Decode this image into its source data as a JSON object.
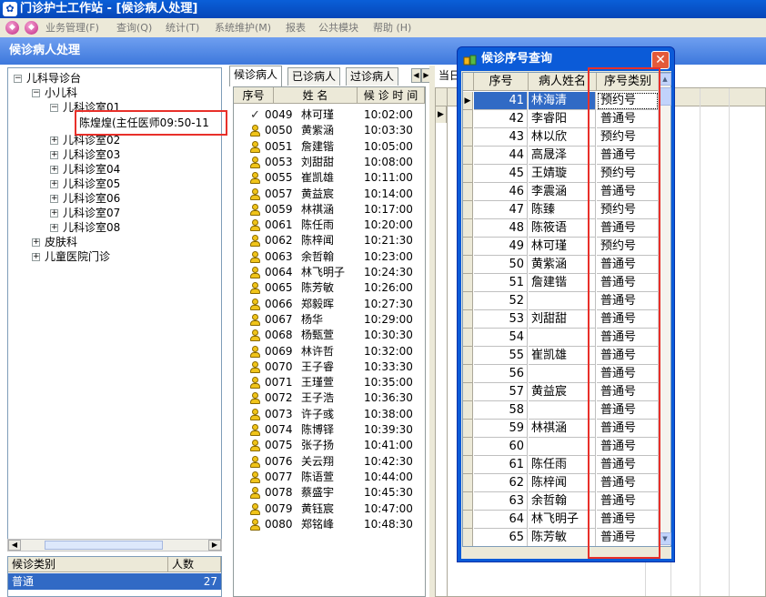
{
  "window": {
    "title": "门诊护士工作站 - [候诊病人处理]"
  },
  "menu": [
    "业务管理(F)",
    "查询(Q)",
    "统计(T)",
    "系统维护(M)",
    "报表",
    "公共模块",
    "帮助 (H)"
  ],
  "header": {
    "title": "候诊病人处理"
  },
  "tree": {
    "root": "儿科导诊台",
    "dept": "小儿科",
    "room_open": "儿科诊室01",
    "doctor": "陈煌煌(主任医师09:50-11",
    "rooms": [
      "儿科诊室02",
      "儿科诊室03",
      "儿科诊室04",
      "儿科诊室05",
      "儿科诊室06",
      "儿科诊室07",
      "儿科诊室08"
    ],
    "others": [
      "皮肤科",
      "儿童医院门诊"
    ]
  },
  "left_grid": {
    "col1": "候诊类别",
    "col2": "人数",
    "row_type": "普通",
    "row_count": "27"
  },
  "tabs": [
    "候诊病人",
    "已诊病人",
    "过诊病人"
  ],
  "right_label": "当日",
  "mid_list": {
    "headers": [
      "序号",
      "姓 名",
      "候 诊 时 间"
    ],
    "rows": [
      {
        "num": "0049",
        "name": "林可瑾",
        "time": "10:02:00"
      },
      {
        "num": "0050",
        "name": "黄紫涵",
        "time": "10:03:30"
      },
      {
        "num": "0051",
        "name": "詹建锴",
        "time": "10:05:00"
      },
      {
        "num": "0053",
        "name": "刘甜甜",
        "time": "10:08:00"
      },
      {
        "num": "0055",
        "name": "崔凯雄",
        "time": "10:11:00"
      },
      {
        "num": "0057",
        "name": "黄益宸",
        "time": "10:14:00"
      },
      {
        "num": "0059",
        "name": "林祺涵",
        "time": "10:17:00"
      },
      {
        "num": "0061",
        "name": "陈任雨",
        "time": "10:20:00"
      },
      {
        "num": "0062",
        "name": "陈梓闻",
        "time": "10:21:30"
      },
      {
        "num": "0063",
        "name": "余哲翰",
        "time": "10:23:00"
      },
      {
        "num": "0064",
        "name": "林飞明子",
        "time": "10:24:30"
      },
      {
        "num": "0065",
        "name": "陈芳敏",
        "time": "10:26:00"
      },
      {
        "num": "0066",
        "name": "郑毅晖",
        "time": "10:27:30"
      },
      {
        "num": "0067",
        "name": "杨华",
        "time": "10:29:00"
      },
      {
        "num": "0068",
        "name": "杨甄萱",
        "time": "10:30:30"
      },
      {
        "num": "0069",
        "name": "林许哲",
        "time": "10:32:00"
      },
      {
        "num": "0070",
        "name": "王子睿",
        "time": "10:33:30"
      },
      {
        "num": "0071",
        "name": "王瑾萱",
        "time": "10:35:00"
      },
      {
        "num": "0072",
        "name": "王子浩",
        "time": "10:36:30"
      },
      {
        "num": "0073",
        "name": "许子彧",
        "time": "10:38:00"
      },
      {
        "num": "0074",
        "name": "陈博铎",
        "time": "10:39:30"
      },
      {
        "num": "0075",
        "name": "张子扬",
        "time": "10:41:00"
      },
      {
        "num": "0076",
        "name": "关云翔",
        "time": "10:42:30"
      },
      {
        "num": "0077",
        "name": "陈语萱",
        "time": "10:44:00"
      },
      {
        "num": "0078",
        "name": "蔡盛宇",
        "time": "10:45:30"
      },
      {
        "num": "0079",
        "name": "黄钰宸",
        "time": "10:47:00"
      },
      {
        "num": "0080",
        "name": "郑铭峰",
        "time": "10:48:30"
      }
    ]
  },
  "dialog": {
    "title": "候诊序号查询",
    "headers": [
      "序号",
      "病人姓名",
      "序号类别"
    ],
    "rows": [
      {
        "seq": "41",
        "name": "林海清",
        "type": "预约号"
      },
      {
        "seq": "42",
        "name": "李睿阳",
        "type": "普通号"
      },
      {
        "seq": "43",
        "name": "林以欣",
        "type": "预约号"
      },
      {
        "seq": "44",
        "name": "高晟泽",
        "type": "普通号"
      },
      {
        "seq": "45",
        "name": "王婧璇",
        "type": "预约号"
      },
      {
        "seq": "46",
        "name": "李震涵",
        "type": "普通号"
      },
      {
        "seq": "47",
        "name": "陈臻",
        "type": "预约号"
      },
      {
        "seq": "48",
        "name": "陈筱语",
        "type": "普通号"
      },
      {
        "seq": "49",
        "name": "林可瑾",
        "type": "预约号"
      },
      {
        "seq": "50",
        "name": "黄紫涵",
        "type": "普通号"
      },
      {
        "seq": "51",
        "name": "詹建锴",
        "type": "普通号"
      },
      {
        "seq": "52",
        "name": "",
        "type": "普通号"
      },
      {
        "seq": "53",
        "name": "刘甜甜",
        "type": "普通号"
      },
      {
        "seq": "54",
        "name": "",
        "type": "普通号"
      },
      {
        "seq": "55",
        "name": "崔凯雄",
        "type": "普通号"
      },
      {
        "seq": "56",
        "name": "",
        "type": "普通号"
      },
      {
        "seq": "57",
        "name": "黄益宸",
        "type": "普通号"
      },
      {
        "seq": "58",
        "name": "",
        "type": "普通号"
      },
      {
        "seq": "59",
        "name": "林祺涵",
        "type": "普通号"
      },
      {
        "seq": "60",
        "name": "",
        "type": "普通号"
      },
      {
        "seq": "61",
        "name": "陈任雨",
        "type": "普通号"
      },
      {
        "seq": "62",
        "name": "陈梓闻",
        "type": "普通号"
      },
      {
        "seq": "63",
        "name": "余哲翰",
        "type": "普通号"
      },
      {
        "seq": "64",
        "name": "林飞明子",
        "type": "普通号"
      },
      {
        "seq": "65",
        "name": "陈芳敏",
        "type": "普通号"
      }
    ]
  },
  "icons": {
    "app": "app-icon",
    "menu": "menu-icon",
    "patient": "patient-icon",
    "called": "called-patient-icon",
    "dialog": "dialog-icon",
    "close": "close-icon"
  },
  "colors": {
    "title_bar": "#0a5fd8",
    "header": "#3d78dc",
    "selection": "#316ac5",
    "highlight_box": "#e8302a",
    "patient_icon": "#f0c419"
  }
}
